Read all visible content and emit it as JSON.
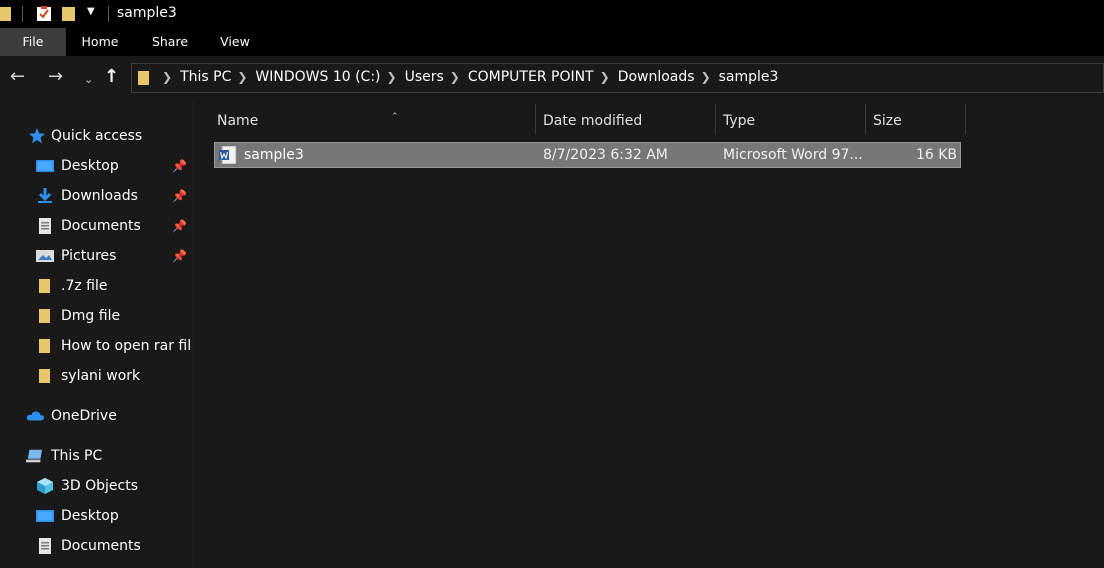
{
  "window": {
    "title": "sample3"
  },
  "ribbon": {
    "tabs": [
      "File",
      "Home",
      "Share",
      "View"
    ]
  },
  "nav": {
    "breadcrumbs": [
      "This PC",
      "WINDOWS 10 (C:)",
      "Users",
      "COMPUTER POINT",
      "Downloads",
      "sample3"
    ]
  },
  "sidebar": {
    "quick_access": "Quick access",
    "pinned": [
      {
        "label": "Desktop",
        "icon": "desktop-icon"
      },
      {
        "label": "Downloads",
        "icon": "downloads-icon"
      },
      {
        "label": "Documents",
        "icon": "documents-icon"
      },
      {
        "label": "Pictures",
        "icon": "pictures-icon"
      }
    ],
    "folders": [
      ".7z file",
      "Dmg file",
      "How to open rar file",
      "sylani work"
    ],
    "onedrive": "OneDrive",
    "this_pc": "This PC",
    "pc_items": [
      "3D Objects",
      "Desktop",
      "Documents"
    ]
  },
  "columns": {
    "name": "Name",
    "date": "Date modified",
    "type": "Type",
    "size": "Size"
  },
  "files": [
    {
      "name": "sample3",
      "date": "8/7/2023 6:32 AM",
      "type": "Microsoft Word 97...",
      "size": "16 KB"
    }
  ],
  "colors": {
    "folder": "#e8c66a",
    "selection": "#777777",
    "accent": "#1e90ff"
  }
}
